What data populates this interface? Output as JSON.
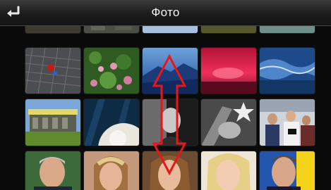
{
  "header": {
    "title": "Фото",
    "back_icon": "return-arrow-icon"
  },
  "colors": {
    "header_bg": "#1c1c1c",
    "page_bg": "#0a0a0a",
    "arrow": "#e8151b"
  },
  "gallery": {
    "rows": [
      [
        "photo-dark-top",
        "photo-tiles-top",
        "photo-blue-top",
        "photo-olive-top",
        "photo-sea-top"
      ],
      [
        "photo-floor-ball",
        "photo-pink-flowers",
        "photo-blue-mountain",
        "photo-red-sunset",
        "photo-blue-wave"
      ],
      [
        "photo-house-lawn",
        "photo-white-sphere",
        "photo-bw-portrait",
        "photo-bw-star",
        "photo-press-crowd"
      ],
      [
        "photo-man-portrait",
        "photo-woman-braid",
        "photo-woman-brown-hair",
        "photo-woman-blonde",
        "photo-man-flag"
      ]
    ]
  },
  "scroll_indicator": {
    "icon": "double-headed-vertical-arrow-icon"
  }
}
